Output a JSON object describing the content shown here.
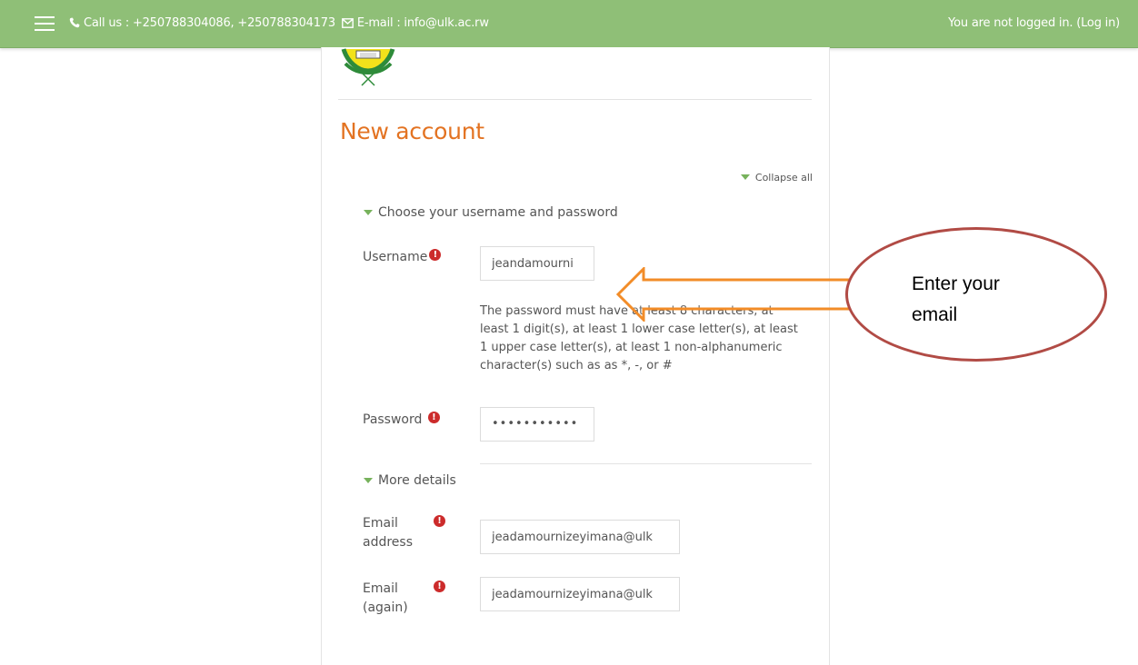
{
  "topbar": {
    "contact_text": "Call us : +250788304086, +250788304173",
    "email_text": "E-mail : info@ulk.ac.rw",
    "login_status": "You are not logged in.",
    "login_link": "(Log in)"
  },
  "page": {
    "title": "New account",
    "collapse_all": "Collapse all"
  },
  "section_credentials": {
    "label": "Choose your username and password",
    "username_label": "Username",
    "username_value": "jeandamourni",
    "password_help": "The password must have at least 8 characters, at least 1 digit(s), at least 1 lower case letter(s), at least 1 upper case letter(s), at least 1 non-alphanumeric character(s) such as as *, -, or #",
    "password_label": "Password",
    "password_value": "•••••••••••"
  },
  "section_details": {
    "label": "More details",
    "email_label_1": "Email",
    "email_label_2": "address",
    "email_value": "jeadamournizeyimana@ulk",
    "email_again_label_1": "Email",
    "email_again_label_2": "(again)",
    "email_again_value": "jeadamournizeyimana@ulk"
  },
  "required_icon": "!",
  "annotation": {
    "callout_text": "Enter your email"
  },
  "colors": {
    "topbar": "#8fbf77",
    "title": "#e37322",
    "required": "#cc2b2b",
    "arrow_stroke": "#f28c28",
    "callout_stroke": "#b14b45"
  }
}
